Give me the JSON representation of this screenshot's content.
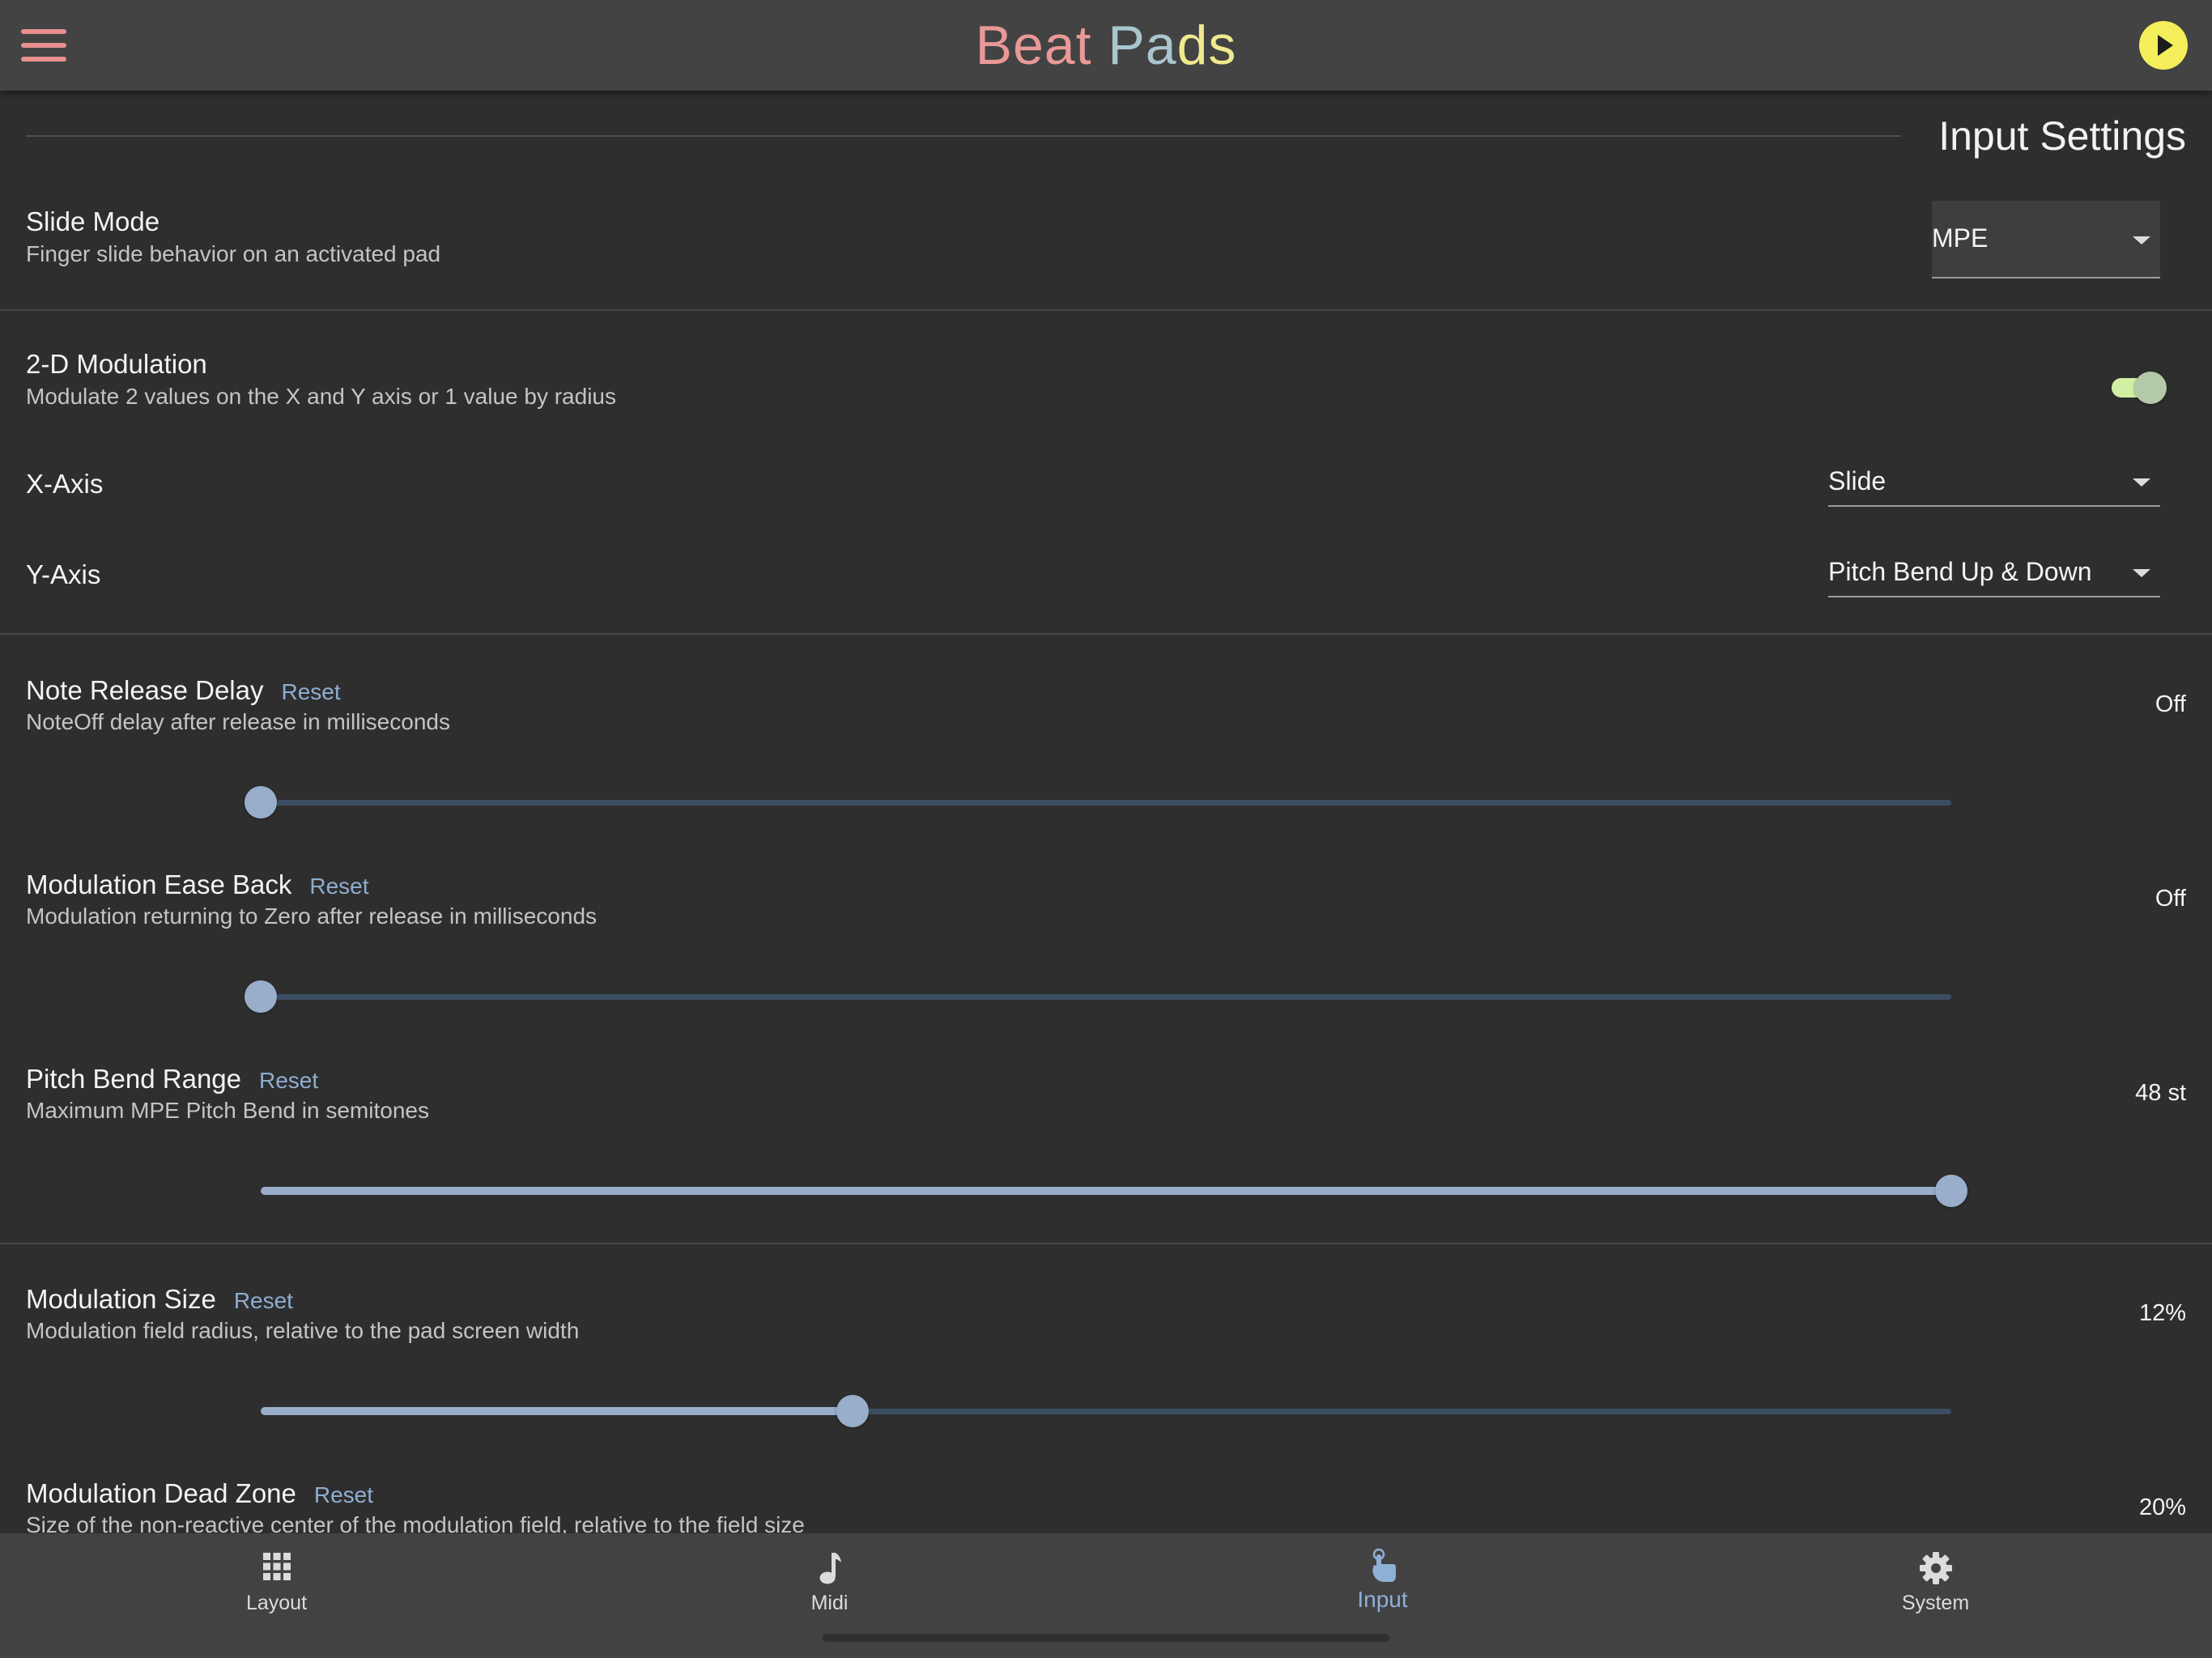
{
  "header": {
    "title_part1": "Beat",
    "title_part2": "Pa",
    "title_part3": "ds"
  },
  "section": {
    "title": "Input Settings"
  },
  "slide_mode": {
    "label": "Slide Mode",
    "description": "Finger slide behavior on an activated pad",
    "selected": "MPE"
  },
  "modulation_2d": {
    "label": "2-D Modulation",
    "description": "Modulate 2 values on the X and Y axis or 1 value by radius",
    "enabled": true
  },
  "x_axis": {
    "label": "X-Axis",
    "selected": "Slide"
  },
  "y_axis": {
    "label": "Y-Axis",
    "selected": "Pitch Bend Up & Down"
  },
  "reset_label": "Reset",
  "sliders": {
    "note_release_delay": {
      "label": "Note Release Delay",
      "description": "NoteOff delay after release in milliseconds",
      "value": "Off",
      "level": 0
    },
    "modulation_ease_back": {
      "label": "Modulation Ease Back",
      "description": "Modulation returning to Zero after release in milliseconds",
      "value": "Off",
      "level": 0
    },
    "pitch_bend_range": {
      "label": "Pitch Bend Range",
      "description": "Maximum MPE Pitch Bend in semitones",
      "value": "48 st",
      "level": 1
    },
    "modulation_size": {
      "label": "Modulation Size",
      "description": "Modulation field radius, relative to the pad screen width",
      "value": "12%",
      "level": 0.35
    },
    "modulation_dead_zone": {
      "label": "Modulation Dead Zone",
      "description": "Size of the non-reactive center of the modulation field, relative to the field size",
      "value": "20%"
    }
  },
  "nav": {
    "items": [
      {
        "label": "Layout",
        "icon": "grid-icon"
      },
      {
        "label": "Midi",
        "icon": "music-note-icon"
      },
      {
        "label": "Input",
        "icon": "touch-icon",
        "active": true
      },
      {
        "label": "System",
        "icon": "gear-icon"
      }
    ]
  },
  "colors": {
    "background": "#2e2e2e",
    "header": "#434343",
    "accent_blue": "#98aecb",
    "title_pink": "#e99898",
    "title_blue": "#a9c6cf",
    "title_yellow": "#f0e98e",
    "play_yellow": "#f5ee5b",
    "toggle_green": "#d3efa4"
  }
}
